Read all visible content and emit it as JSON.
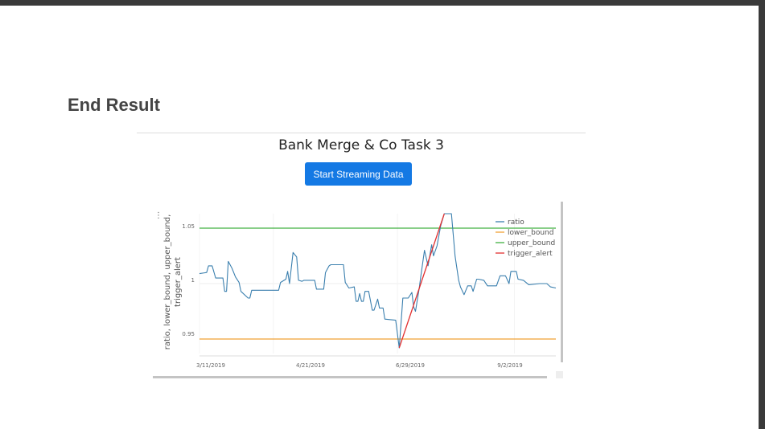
{
  "page": {
    "heading": "End Result",
    "app_title": "Bank Merge & Co Task 3",
    "button_label": "Start Streaming Data"
  },
  "chart_data": {
    "type": "line",
    "title": "",
    "xlabel": "",
    "ylabel_lines": [
      "ratio, lower_bound, upper_bound,",
      "trigger_alert"
    ],
    "x_ticks": [
      "3/11/2019",
      "4/21/2019",
      "6/29/2019",
      "9/2/2019"
    ],
    "y_ticks": [
      "1.05",
      "1",
      "0.95"
    ],
    "ylim": [
      0.937,
      1.063
    ],
    "grid": true,
    "legend_position": "top-right",
    "menu_glyph": "⋮",
    "colors": {
      "ratio": "#3a7fae",
      "lower_bound": "#f0a035",
      "upper_bound": "#40b040",
      "trigger_alert": "#e23030",
      "button": "#1479e4"
    },
    "series": [
      {
        "name": "ratio",
        "points": [
          [
            "2019-03-11",
            1.009
          ],
          [
            "2019-03-15",
            1.01
          ],
          [
            "2019-03-16",
            1.016
          ],
          [
            "2019-03-18",
            1.016
          ],
          [
            "2019-03-20",
            1.005
          ],
          [
            "2019-03-24",
            1.005
          ],
          [
            "2019-03-25",
            0.993
          ],
          [
            "2019-03-26",
            0.993
          ],
          [
            "2019-03-27",
            1.02
          ],
          [
            "2019-03-29",
            1.014
          ],
          [
            "2019-03-31",
            1.006
          ],
          [
            "2019-04-02",
            1.001
          ],
          [
            "2019-04-03",
            0.993
          ],
          [
            "2019-04-07",
            0.987
          ],
          [
            "2019-04-08",
            0.987
          ],
          [
            "2019-04-09",
            0.994
          ],
          [
            "2019-04-24",
            0.994
          ],
          [
            "2019-04-25",
            1.001
          ],
          [
            "2019-04-28",
            1.004
          ],
          [
            "2019-04-29",
            1.011
          ],
          [
            "2019-04-30",
            1.0
          ],
          [
            "2019-05-02",
            1.028
          ],
          [
            "2019-05-04",
            1.024
          ],
          [
            "2019-05-05",
            1.003
          ],
          [
            "2019-05-07",
            1.002
          ],
          [
            "2019-05-08",
            1.003
          ],
          [
            "2019-05-14",
            1.003
          ],
          [
            "2019-05-15",
            0.995
          ],
          [
            "2019-05-19",
            0.995
          ],
          [
            "2019-05-20",
            1.01
          ],
          [
            "2019-05-22",
            1.016
          ],
          [
            "2019-05-23",
            1.017
          ],
          [
            "2019-05-30",
            1.017
          ],
          [
            "2019-05-31",
            1.001
          ],
          [
            "2019-06-02",
            0.996
          ],
          [
            "2019-06-05",
            0.997
          ],
          [
            "2019-06-06",
            0.984
          ],
          [
            "2019-06-07",
            0.984
          ],
          [
            "2019-06-08",
            0.991
          ],
          [
            "2019-06-09",
            0.984
          ],
          [
            "2019-06-10",
            0.984
          ],
          [
            "2019-06-11",
            0.993
          ],
          [
            "2019-06-13",
            0.993
          ],
          [
            "2019-06-15",
            0.976
          ],
          [
            "2019-06-16",
            0.976
          ],
          [
            "2019-06-18",
            0.986
          ],
          [
            "2019-06-19",
            0.978
          ],
          [
            "2019-06-21",
            0.978
          ],
          [
            "2019-06-22",
            0.968
          ],
          [
            "2019-06-28",
            0.967
          ],
          [
            "2019-06-30",
            0.942
          ],
          [
            "2019-07-02",
            0.987
          ],
          [
            "2019-07-05",
            0.987
          ],
          [
            "2019-07-07",
            0.992
          ],
          [
            "2019-07-08",
            0.979
          ],
          [
            "2019-07-09",
            0.975
          ],
          [
            "2019-07-11",
            0.995
          ],
          [
            "2019-07-12",
            1.007
          ],
          [
            "2019-07-14",
            1.03
          ],
          [
            "2019-07-16",
            1.016
          ],
          [
            "2019-07-18",
            1.035
          ],
          [
            "2019-07-19",
            1.025
          ],
          [
            "2019-07-21",
            1.034
          ],
          [
            "2019-07-23",
            1.052
          ],
          [
            "2019-07-25",
            1.063
          ],
          [
            "2019-07-29",
            1.063
          ],
          [
            "2019-07-31",
            1.025
          ],
          [
            "2019-08-02",
            1.003
          ],
          [
            "2019-08-03",
            0.997
          ],
          [
            "2019-08-05",
            0.99
          ],
          [
            "2019-08-07",
            0.998
          ],
          [
            "2019-08-09",
            0.998
          ],
          [
            "2019-08-10",
            0.993
          ],
          [
            "2019-08-12",
            1.004
          ],
          [
            "2019-08-13",
            1.004
          ],
          [
            "2019-08-16",
            1.003
          ],
          [
            "2019-08-18",
            0.998
          ],
          [
            "2019-08-23",
            0.998
          ],
          [
            "2019-08-25",
            1.007
          ],
          [
            "2019-08-28",
            1.007
          ],
          [
            "2019-08-30",
            1.0
          ],
          [
            "2019-08-31",
            1.011
          ],
          [
            "2019-09-03",
            1.011
          ],
          [
            "2019-09-04",
            1.004
          ],
          [
            "2019-09-07",
            1.003
          ],
          [
            "2019-09-10",
            0.999
          ],
          [
            "2019-09-16",
            1.0
          ],
          [
            "2019-09-20",
            1.0
          ],
          [
            "2019-09-22",
            0.997
          ],
          [
            "2019-09-25",
            0.996
          ]
        ]
      },
      {
        "name": "lower_bound",
        "points": [
          [
            "2019-03-11",
            0.95
          ],
          [
            "2019-09-25",
            0.95
          ]
        ]
      },
      {
        "name": "upper_bound",
        "points": [
          [
            "2019-03-11",
            1.05
          ],
          [
            "2019-09-25",
            1.05
          ]
        ]
      },
      {
        "name": "trigger_alert",
        "points": [
          [
            "2019-06-30",
            0.942
          ],
          [
            "2019-07-25",
            1.063
          ]
        ]
      }
    ]
  }
}
